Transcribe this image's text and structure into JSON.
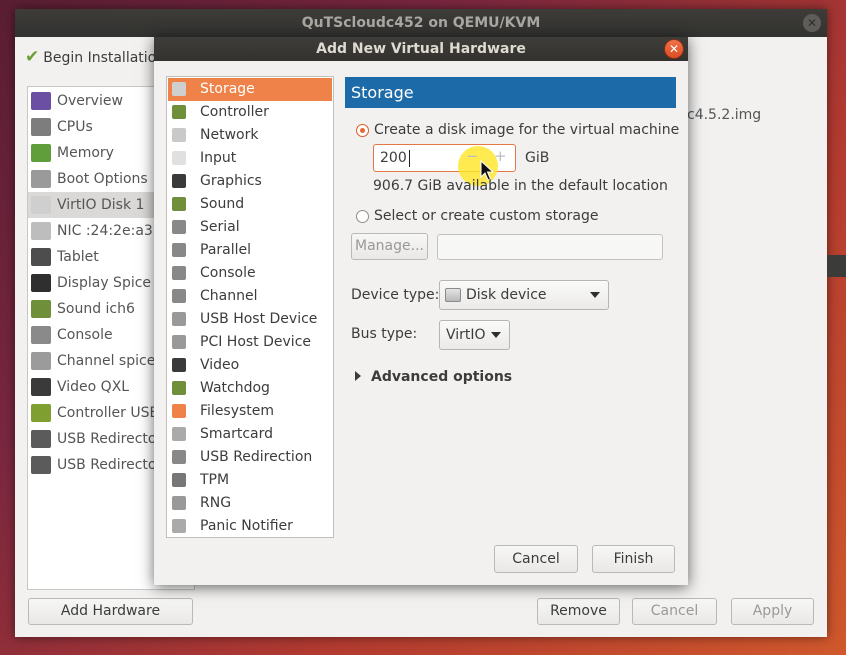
{
  "main_window": {
    "title": "QuTScloudc452 on QEMU/KVM",
    "begin_installation": "Begin Installation",
    "hardware_items": [
      {
        "label": "Overview",
        "icon": "overview-icon"
      },
      {
        "label": "CPUs",
        "icon": "cpu-icon"
      },
      {
        "label": "Memory",
        "icon": "memory-icon"
      },
      {
        "label": "Boot Options",
        "icon": "boot-options-icon"
      },
      {
        "label": "VirtIO Disk 1",
        "icon": "disk-icon",
        "selected": true
      },
      {
        "label": "NIC :24:2e:a3",
        "icon": "nic-icon"
      },
      {
        "label": "Tablet",
        "icon": "tablet-icon"
      },
      {
        "label": "Display Spice",
        "icon": "display-icon"
      },
      {
        "label": "Sound ich6",
        "icon": "sound-icon"
      },
      {
        "label": "Console",
        "icon": "console-icon"
      },
      {
        "label": "Channel spice",
        "icon": "channel-icon"
      },
      {
        "label": "Video QXL",
        "icon": "video-icon"
      },
      {
        "label": "Controller USB",
        "icon": "controller-icon"
      },
      {
        "label": "USB Redirector",
        "icon": "usb-icon"
      },
      {
        "label": "USB Redirector",
        "icon": "usb-icon"
      }
    ],
    "background_file_text": "c4.5.2.img",
    "add_hardware": "Add Hardware",
    "remove": "Remove",
    "cancel": "Cancel",
    "apply": "Apply"
  },
  "dialog": {
    "title": "Add New Virtual Hardware",
    "device_types": [
      {
        "label": "Storage",
        "icon": "storage-icon",
        "selected": true
      },
      {
        "label": "Controller",
        "icon": "controller-icon"
      },
      {
        "label": "Network",
        "icon": "network-icon"
      },
      {
        "label": "Input",
        "icon": "mouse-icon"
      },
      {
        "label": "Graphics",
        "icon": "monitor-icon"
      },
      {
        "label": "Sound",
        "icon": "sound-card-icon"
      },
      {
        "label": "Serial",
        "icon": "serial-icon"
      },
      {
        "label": "Parallel",
        "icon": "parallel-icon"
      },
      {
        "label": "Console",
        "icon": "console-icon"
      },
      {
        "label": "Channel",
        "icon": "channel-icon"
      },
      {
        "label": "USB Host Device",
        "icon": "usb-host-icon"
      },
      {
        "label": "PCI Host Device",
        "icon": "pci-icon"
      },
      {
        "label": "Video",
        "icon": "video-icon"
      },
      {
        "label": "Watchdog",
        "icon": "watchdog-icon"
      },
      {
        "label": "Filesystem",
        "icon": "folder-icon"
      },
      {
        "label": "Smartcard",
        "icon": "smartcard-icon"
      },
      {
        "label": "USB Redirection",
        "icon": "usb-redirection-icon"
      },
      {
        "label": "TPM",
        "icon": "tpm-icon"
      },
      {
        "label": "RNG",
        "icon": "rng-icon"
      },
      {
        "label": "Panic Notifier",
        "icon": "panic-icon"
      }
    ],
    "panel_title": "Storage",
    "option_create": "Create a disk image for the virtual machine",
    "size_value": "200",
    "size_unit": "GiB",
    "available_text": "906.7 GiB available in the default location",
    "option_custom": "Select or create custom storage",
    "manage_button": "Manage...",
    "custom_path": "",
    "device_type_label": "Device type:",
    "device_type_value": "Disk device",
    "bus_type_label": "Bus type:",
    "bus_type_value": "VirtIO",
    "advanced_options": "Advanced options",
    "cancel": "Cancel",
    "finish": "Finish"
  },
  "colors": {
    "selection_orange": "#ee8248",
    "header_blue": "#1c6aa8",
    "title_bar": "#33322f"
  }
}
